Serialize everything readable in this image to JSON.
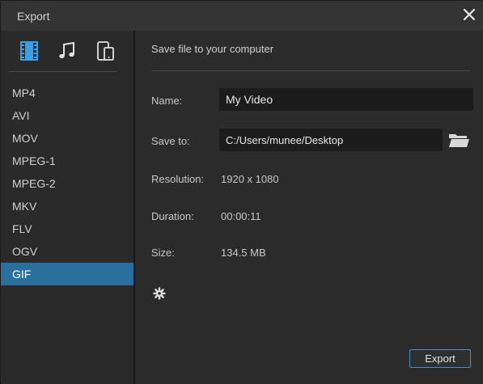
{
  "window": {
    "title": "Export"
  },
  "categories": [
    {
      "name": "video",
      "icon": "film-icon",
      "color": "#3ba0e6",
      "active": true
    },
    {
      "name": "audio",
      "icon": "music-note-icon",
      "color": "#e0e0e0",
      "active": false
    },
    {
      "name": "devices",
      "icon": "devices-icon",
      "color": "#e0e0e0",
      "active": false
    }
  ],
  "formats": [
    "MP4",
    "AVI",
    "MOV",
    "MPEG-1",
    "MPEG-2",
    "MKV",
    "FLV",
    "OGV",
    "GIF"
  ],
  "selected_format": "GIF",
  "main": {
    "heading": "Save file to your computer",
    "name_label": "Name:",
    "name_value": "My Video",
    "save_to_label": "Save to:",
    "save_to_value": "C:/Users/munee/Desktop",
    "resolution_label": "Resolution:",
    "resolution_value": "1920 x 1080",
    "duration_label": "Duration:",
    "duration_value": "00:00:11",
    "size_label": "Size:",
    "size_value": "134.5 MB",
    "settings_icon": "gear-icon",
    "browse_icon": "folder-icon"
  },
  "footer": {
    "export_label": "Export"
  },
  "colors": {
    "accent": "#2a6f9e",
    "button_border": "#4a8fc3",
    "background": "#2b2b2b",
    "field_background": "#1c1c1c"
  }
}
